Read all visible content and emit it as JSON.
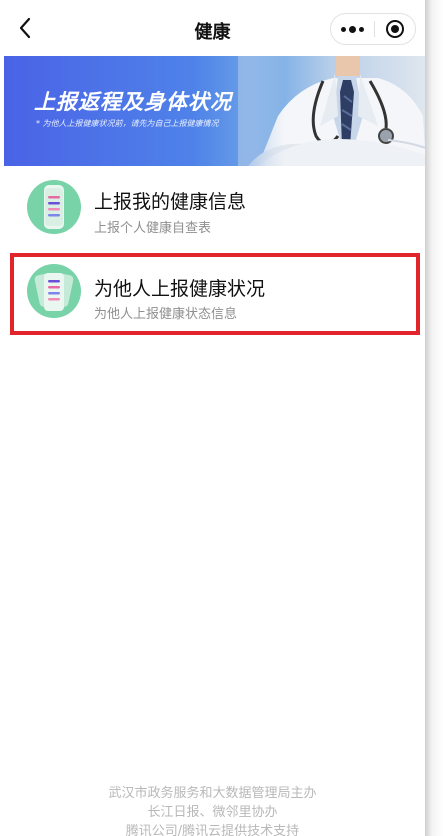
{
  "navbar": {
    "title": "健康",
    "back_icon": "chevron-left-icon",
    "more_icon": "more-dots-icon",
    "close_icon": "target-circle-icon"
  },
  "banner": {
    "title": "上报返程及身体状况",
    "subtitle": "* 为他人上报健康状况前，请先为自己上报健康情况",
    "image": "doctor-photo"
  },
  "items": [
    {
      "title": "上报我的健康信息",
      "subtitle": "上报个人健康自查表",
      "icon": "health-form-icon"
    },
    {
      "title": "为他人上报健康状况",
      "subtitle": "为他人上报健康状态信息",
      "icon": "health-forms-stack-icon"
    }
  ],
  "footer": {
    "line1": "武汉市政务服务和大数据管理局主办",
    "line2": "长江日报、微邻里协办",
    "line3": "腾讯公司/腾讯云提供技术支持"
  },
  "colors": {
    "accent_green": "#78d3a8",
    "banner_blue": "#4a63e6",
    "highlight_red": "#e2242b"
  }
}
